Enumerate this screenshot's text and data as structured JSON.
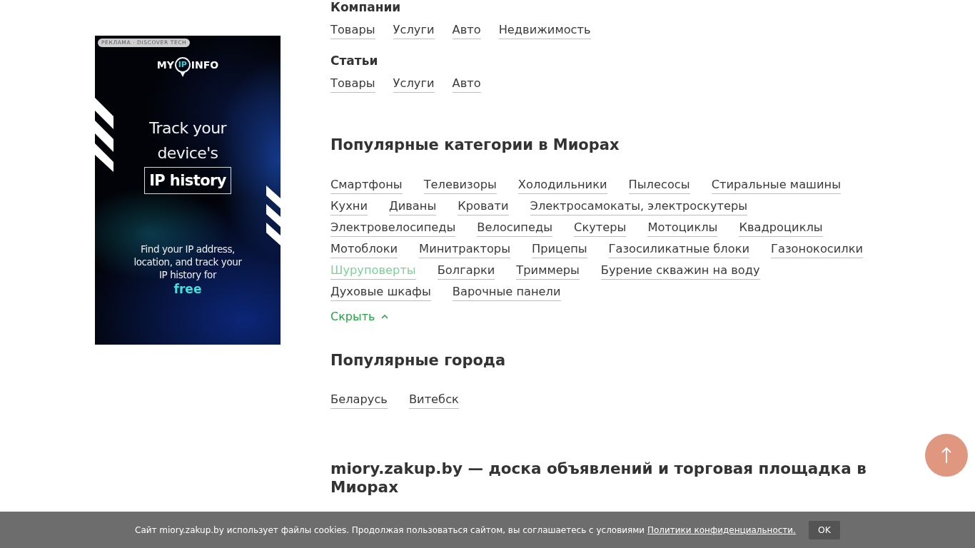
{
  "ad": {
    "label": "РЕКЛАМА · DISCOVER TECH",
    "logo": {
      "left": "MY",
      "center": "IP",
      "right": "INFO"
    },
    "headline": "Track your device's",
    "highlight": "IP history",
    "body": "Find your IP address, location, and track your IP history for",
    "accent": "free"
  },
  "sections": [
    {
      "title": "Компании",
      "links": [
        "Товары",
        "Услуги",
        "Авто",
        "Недвижимость"
      ]
    },
    {
      "title": "Статьи",
      "links": [
        "Товары",
        "Услуги",
        "Авто"
      ]
    }
  ],
  "popular_categories": {
    "title": "Популярные категории в Миорах",
    "expanded": true,
    "toggle": "Скрыть",
    "links": [
      {
        "label": "Смартфоны",
        "highlighted": false
      },
      {
        "label": "Телевизоры",
        "highlighted": false
      },
      {
        "label": "Холодильники",
        "highlighted": false
      },
      {
        "label": "Пылесосы",
        "highlighted": false
      },
      {
        "label": "Стиральные машины",
        "highlighted": false
      },
      {
        "label": "Кухни",
        "highlighted": false
      },
      {
        "label": "Диваны",
        "highlighted": false
      },
      {
        "label": "Кровати",
        "highlighted": false
      },
      {
        "label": "Электросамокаты, электроскутеры",
        "highlighted": false
      },
      {
        "label": "Электровелосипеды",
        "highlighted": false
      },
      {
        "label": "Велосипеды",
        "highlighted": false
      },
      {
        "label": "Скутеры",
        "highlighted": false
      },
      {
        "label": "Мотоциклы",
        "highlighted": false
      },
      {
        "label": "Квадроциклы",
        "highlighted": false
      },
      {
        "label": "Мотоблоки",
        "highlighted": false
      },
      {
        "label": "Минитракторы",
        "highlighted": false
      },
      {
        "label": "Прицепы",
        "highlighted": false
      },
      {
        "label": "Газосиликатные блоки",
        "highlighted": false
      },
      {
        "label": "Газонокосилки",
        "highlighted": false
      },
      {
        "label": "Шуруповерты",
        "highlighted": true
      },
      {
        "label": "Болгарки",
        "highlighted": false
      },
      {
        "label": "Триммеры",
        "highlighted": false
      },
      {
        "label": "Бурение скважин на воду",
        "highlighted": false
      },
      {
        "label": "Духовые шкафы",
        "highlighted": false
      },
      {
        "label": "Варочные панели",
        "highlighted": false
      }
    ]
  },
  "popular_cities": {
    "title": "Популярные города",
    "links": [
      "Беларусь",
      "Витебск"
    ]
  },
  "about": {
    "title": "miory.zakup.by — доска объявлений и торговая площадка в Миорах"
  },
  "cookie_bar": {
    "text": "Сайт miory.zakup.by использует файлы cookies. Продолжая пользоваться сайтом, вы соглашаетесь с условиями",
    "link": "Политики конфиденциальности.",
    "button": "OK"
  }
}
